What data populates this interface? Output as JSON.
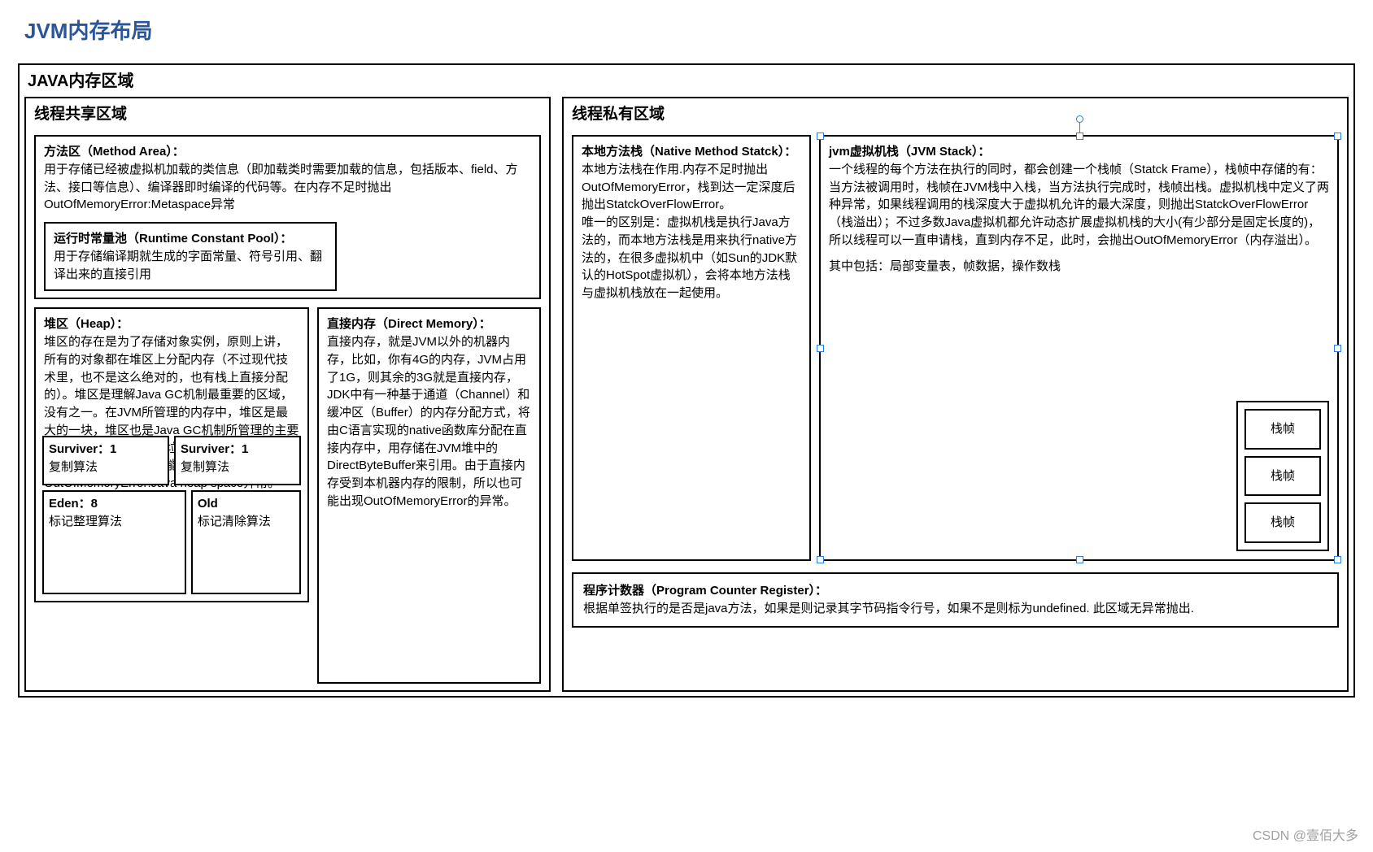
{
  "title": "JVM内存布局",
  "outer": {
    "label": "JAVA内存区域"
  },
  "shared": {
    "label": "线程共享区域",
    "methodArea": {
      "heading": "方法区（Method Area）：",
      "body": "用于存储已经被虚拟机加载的类信息（即加载类时需要加载的信息，包括版本、field、方法、接口等信息）、编译器即时编译的代码等。在内存不足时抛出OutOfMemoryError:Metaspace异常",
      "rcp": {
        "heading": "运行时常量池（Runtime Constant Pool）：",
        "body": "用于存储编译期就生成的字面常量、符号引用、翻译出来的直接引用"
      }
    },
    "heap": {
      "heading": "堆区（Heap）：",
      "body": "堆区的存在是为了存储对象实例，原则上讲，所有的对象都在堆区上分配内存（不过现代技术里，也不是这么绝对的，也有栈上直接分配的）。堆区是理解Java GC机制最重要的区域，没有之一。在JVM所管理的内存中，堆区是最大的一块，堆区也是Java GC机制所管理的主要内存区域。如果在执行垃圾回收之后，仍没有足够的内存分配，也不能再扩展，将会抛出OutOfMemoryError:Java heap space异常。",
      "surv1": {
        "title": "Surviver：1",
        "algo": "复制算法"
      },
      "surv2": {
        "title": "Surviver：1",
        "algo": "复制算法"
      },
      "eden": {
        "title": "Eden：8",
        "algo": "标记整理算法"
      },
      "old": {
        "title": "Old",
        "algo": "标记清除算法"
      }
    },
    "direct": {
      "heading": "直接内存（Direct Memory）：",
      "body": "直接内存，就是JVM以外的机器内存，比如，你有4G的内存，JVM占用了1G，则其余的3G就是直接内存，JDK中有一种基于通道（Channel）和缓冲区（Buffer）的内存分配方式，将由C语言实现的native函数库分配在直接内存中，用存储在JVM堆中的DirectByteBuffer来引用。由于直接内存受到本机器内存的限制，所以也可能出现OutOfMemoryError的异常。"
    }
  },
  "private": {
    "label": "线程私有区域",
    "native": {
      "heading": "本地方法栈（Native Method Statck）：",
      "body": "本地方法栈在作用.内存不足时抛出OutOfMemoryError，栈到达一定深度后抛出StatckOverFlowError。\n唯一的区别是：虚拟机栈是执行Java方法的，而本地方法栈是用来执行native方法的，在很多虚拟机中（如Sun的JDK默认的HotSpot虚拟机），会将本地方法栈与虚拟机栈放在一起使用。"
    },
    "jvm": {
      "heading": "jvm虚拟机栈（JVM Stack）：",
      "body": "一个线程的每个方法在执行的同时，都会创建一个栈帧（Statck Frame），栈帧中存储的有：当方法被调用时，栈帧在JVM栈中入栈，当方法执行完成时，栈帧出栈。虚拟机栈中定义了两种异常，如果线程调用的栈深度大于虚拟机允许的最大深度，则抛出StatckOverFlowError（栈溢出）；不过多数Java虚拟机都允许动态扩展虚拟机栈的大小(有少部分是固定长度的)，所以线程可以一直申请栈，直到内存不足，此时，会抛出OutOfMemoryError（内存溢出）。",
      "extra": "其中包括：局部变量表，帧数据，操作数栈",
      "frame1": "栈帧",
      "frame2": "栈帧",
      "frame3": "栈帧"
    },
    "pc": {
      "heading": "程序计数器（Program Counter Register）：",
      "body": "根据单签执行的是否是java方法，如果是则记录其字节码指令行号，如果不是则标为undefined. 此区域无异常抛出."
    }
  },
  "watermark": "CSDN @壹佰大多"
}
